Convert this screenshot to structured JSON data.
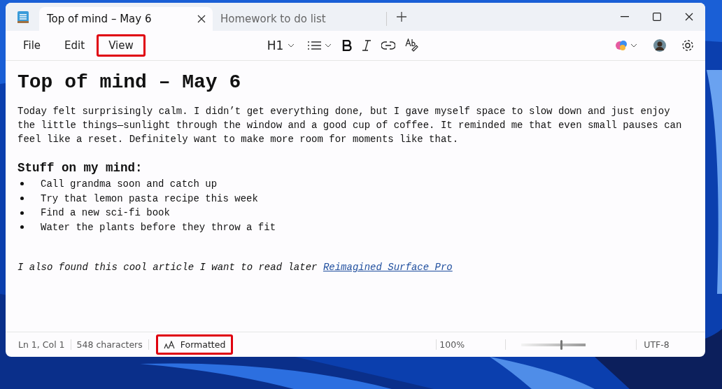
{
  "tabs": [
    {
      "label": "Top of mind – May 6",
      "selected": true
    },
    {
      "label": "Homework to do list",
      "selected": false
    }
  ],
  "menu": [
    {
      "label": "File",
      "highlighted": false
    },
    {
      "label": "Edit",
      "highlighted": false
    },
    {
      "label": "View",
      "highlighted": true
    }
  ],
  "toolbar": {
    "heading": "H1"
  },
  "document": {
    "title": "Top of mind – May 6",
    "paragraph": "Today felt surprisingly calm. I didn’t get everything done, but I gave myself space to slow down and just enjoy the little things—sunlight through the window and a good cup of coffee. It reminded me that even small pauses can feel like a reset. Definitely want to make more room for moments like that.",
    "subheading": "Stuff on my mind:",
    "bullets": [
      "Call grandma soon and catch up",
      "Try that lemon pasta recipe this week",
      "Find a new sci-fi book",
      "Water the plants before they throw a fit"
    ],
    "note": "I also found this cool article I want to read later",
    "link": "Reimagined Surface Pro"
  },
  "status_bar": {
    "position": "Ln 1, Col 1",
    "characters": "548 characters",
    "format": {
      "label": "Formatted",
      "highlighted": true
    },
    "zoom": "100%",
    "zoom_slider": {
      "level": 0.6
    },
    "encoding": "UTF-8"
  }
}
